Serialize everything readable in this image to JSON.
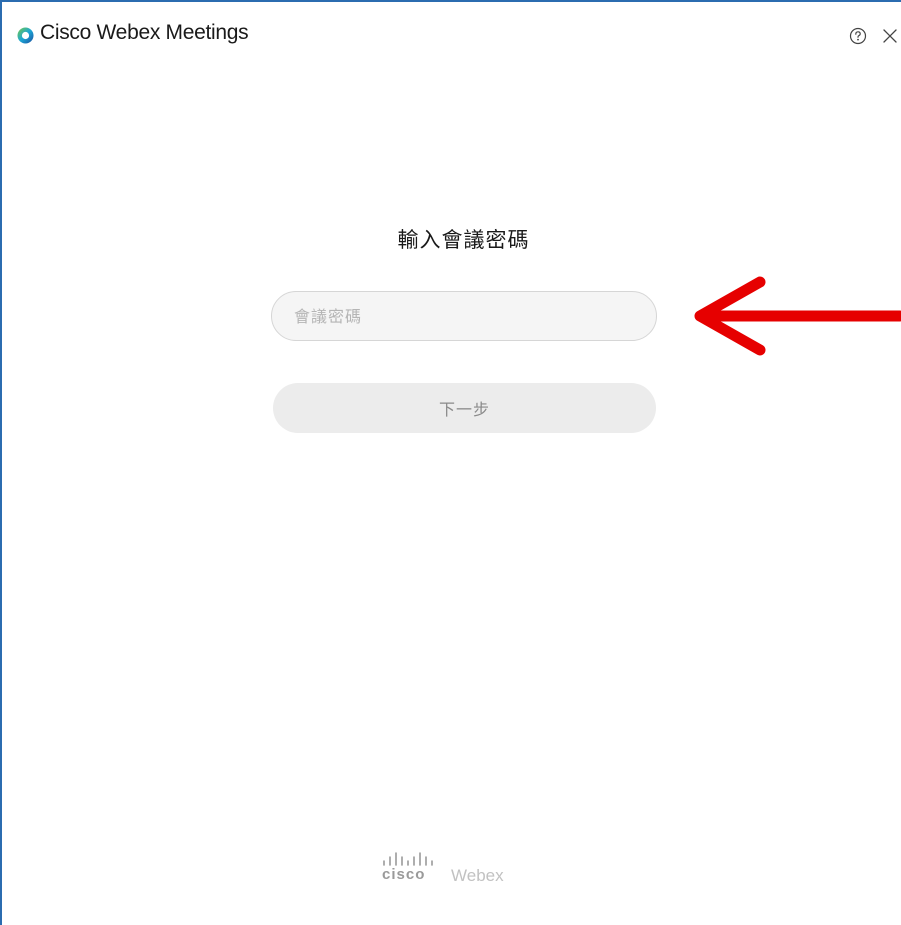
{
  "window": {
    "title": "Cisco Webex Meetings",
    "accent_color": "#2b6cb0"
  },
  "titlebar": {
    "app_icon": "webex-logo-icon",
    "help_icon": "help-circle-icon",
    "close_icon": "close-icon"
  },
  "main": {
    "heading": "輸入會議密碼",
    "password_input": {
      "placeholder": "會議密碼",
      "value": ""
    },
    "next_button_label": "下一步"
  },
  "annotation": {
    "arrow_color": "#e60000",
    "arrow_icon": "left-arrow-icon"
  },
  "footer": {
    "brand": "cisco",
    "product": "Webex"
  }
}
